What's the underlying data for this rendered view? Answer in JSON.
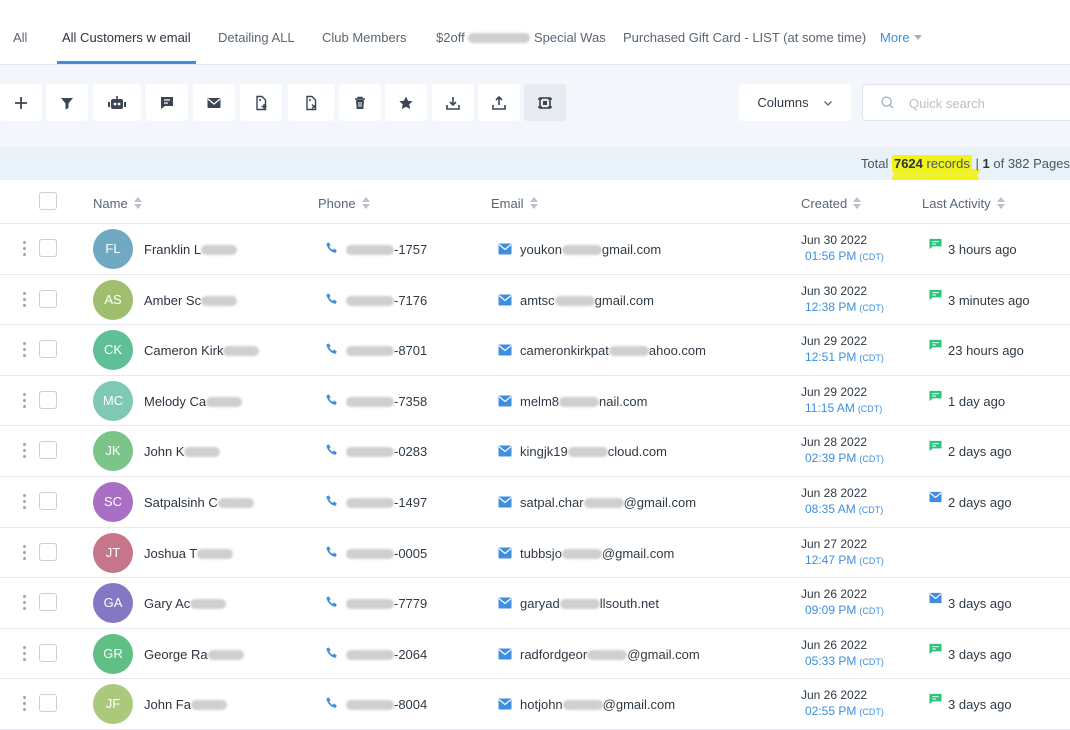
{
  "tabs": [
    {
      "label": "All",
      "active": false
    },
    {
      "label": "All Customers w email",
      "active": true
    },
    {
      "label": "Detailing ALL",
      "active": false
    },
    {
      "label": "Club Members",
      "active": false
    },
    {
      "label_pre": "$2off",
      "label_post": "Special Was",
      "active": false
    },
    {
      "label": "Purchased Gift Card - LIST (at some time)",
      "active": false
    }
  ],
  "more_label": "More",
  "toolbar": {
    "buttons": [
      {
        "icon": "plus-icon"
      },
      {
        "icon": "filter-icon"
      },
      {
        "icon": "robot-icon"
      },
      {
        "icon": "message-icon"
      },
      {
        "icon": "email-icon"
      },
      {
        "icon": "add-tag-icon"
      },
      {
        "icon": "remove-tag-icon"
      },
      {
        "icon": "trash-icon"
      },
      {
        "icon": "star-icon"
      },
      {
        "icon": "import-icon"
      },
      {
        "icon": "export-icon"
      },
      {
        "icon": "merge-icon"
      }
    ],
    "columns_label": "Columns",
    "search_placeholder": "Quick search"
  },
  "totals": {
    "prefix": "Total",
    "records": "7624",
    "records_word": "records",
    "separator": "|",
    "page": "1",
    "pages_text": "of 382 Pages"
  },
  "headers": {
    "name": "Name",
    "phone": "Phone",
    "email": "Email",
    "created": "Created",
    "last_activity": "Last Activity"
  },
  "colors": {
    "accent": "#3f8ee0",
    "activity_green": "#2fc47e",
    "activity_blue": "#3f8ee0",
    "highlight": "#f0f21a"
  },
  "rows": [
    {
      "initials": "FL",
      "color": "#6fa9c2",
      "name": "Franklin L",
      "phone_end": "-1757",
      "email_pre": "youkon",
      "email_post": "gmail.com",
      "date": "Jun 30 2022",
      "time": "01:56 PM",
      "tz": "(CDT)",
      "activity": "3 hours ago",
      "activity_icon": "message-icon"
    },
    {
      "initials": "AS",
      "color": "#9fbf6e",
      "name": "Amber Sc",
      "phone_end": "-7176",
      "email_pre": "amtsc",
      "email_post": "gmail.com",
      "date": "Jun 30 2022",
      "time": "12:38 PM",
      "tz": "(CDT)",
      "activity": "3 minutes ago",
      "activity_icon": "message-icon"
    },
    {
      "initials": "CK",
      "color": "#5fbf95",
      "name": "Cameron Kirk",
      "phone_end": "-8701",
      "email_pre": "cameronkirkpat",
      "email_post": "ahoo.com",
      "date": "Jun 29 2022",
      "time": "12:51 PM",
      "tz": "(CDT)",
      "activity": "23 hours ago",
      "activity_icon": "message-icon"
    },
    {
      "initials": "MC",
      "color": "#7fc8b5",
      "name": "Melody Ca",
      "phone_end": "-7358",
      "email_pre": "melm8",
      "email_post": "nail.com",
      "date": "Jun 29 2022",
      "time": "11:15 AM",
      "tz": "(CDT)",
      "activity": "1 day ago",
      "activity_icon": "message-icon"
    },
    {
      "initials": "JK",
      "color": "#7bc48a",
      "name": "John K",
      "phone_end": "-0283",
      "email_pre": "kingjk19",
      "email_post": "cloud.com",
      "date": "Jun 28 2022",
      "time": "02:39 PM",
      "tz": "(CDT)",
      "activity": "2 days ago",
      "activity_icon": "message-icon"
    },
    {
      "initials": "SC",
      "color": "#a86fc4",
      "name": "Satpalsinh C",
      "phone_end": "-1497",
      "email_pre": "satpal.char",
      "email_post": "@gmail.com",
      "date": "Jun 28 2022",
      "time": "08:35 AM",
      "tz": "(CDT)",
      "activity": "2 days ago",
      "activity_icon": "email-icon"
    },
    {
      "initials": "JT",
      "color": "#c5768a",
      "name": "Joshua T",
      "phone_end": "-0005",
      "email_pre": "tubbsjo",
      "email_post": "@gmail.com",
      "date": "Jun 27 2022",
      "time": "12:47 PM",
      "tz": "(CDT)",
      "activity": "",
      "activity_icon": ""
    },
    {
      "initials": "GA",
      "color": "#8478c4",
      "name": "Gary Ac",
      "phone_end": "-7779",
      "email_pre": "garyad",
      "email_post": "llsouth.net",
      "date": "Jun 26 2022",
      "time": "09:09 PM",
      "tz": "(CDT)",
      "activity": "3 days ago",
      "activity_icon": "email-icon"
    },
    {
      "initials": "GR",
      "color": "#5fbf85",
      "name": "George Ra",
      "phone_end": "-2064",
      "email_pre": "radfordgeor",
      "email_post": "@gmail.com",
      "date": "Jun 26 2022",
      "time": "05:33 PM",
      "tz": "(CDT)",
      "activity": "3 days ago",
      "activity_icon": "message-icon"
    },
    {
      "initials": "JF",
      "color": "#aac97a",
      "name": "John Fa",
      "phone_end": "-8004",
      "email_pre": "hotjohn",
      "email_post": "@gmail.com",
      "date": "Jun 26 2022",
      "time": "02:55 PM",
      "tz": "(CDT)",
      "activity": "3 days ago",
      "activity_icon": "message-icon"
    }
  ]
}
